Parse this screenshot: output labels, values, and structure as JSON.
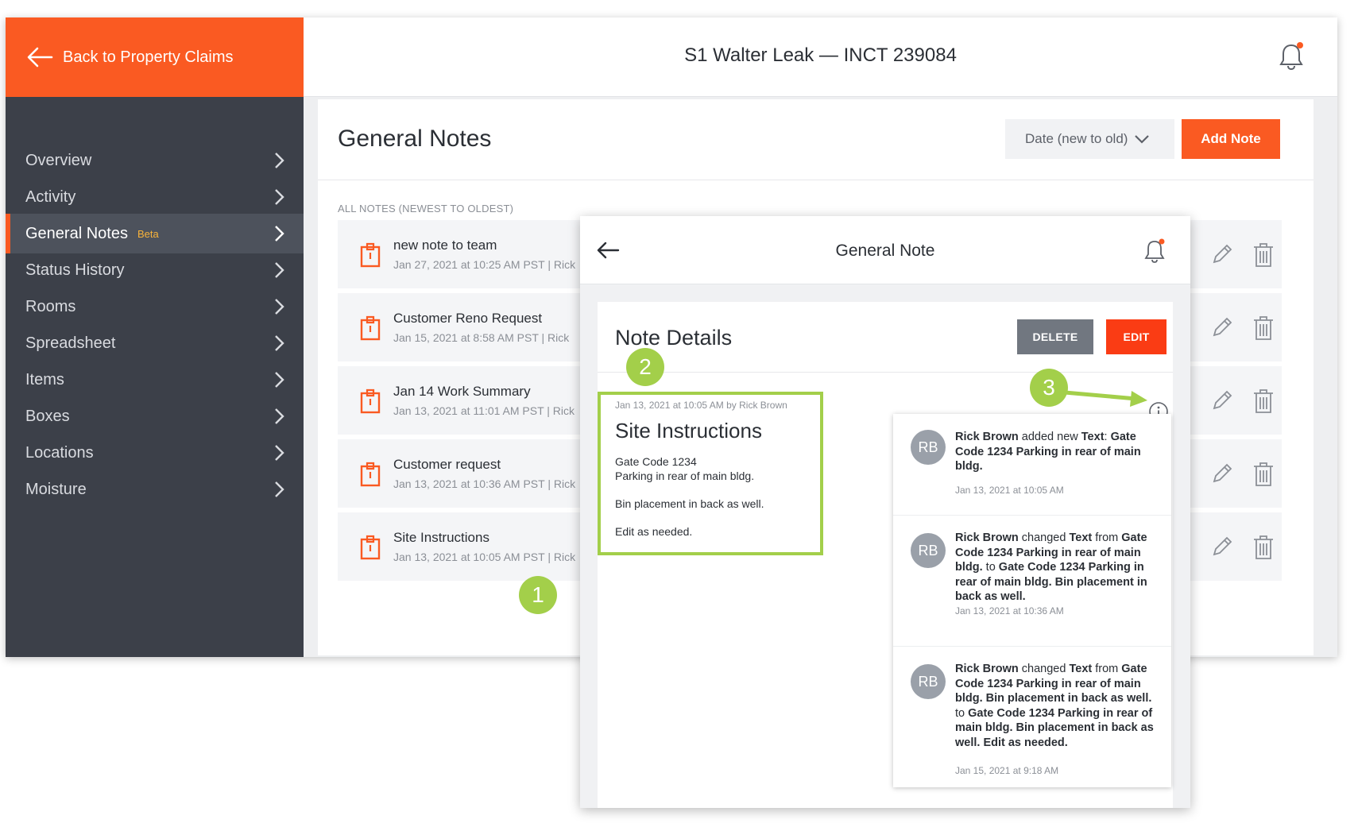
{
  "back_label": "Back to Property Claims",
  "header": {
    "title": "S1 Walter Leak — INCT 239084",
    "notification_dot_color": "#fa5a22"
  },
  "sidebar": {
    "items": [
      {
        "label": "Overview"
      },
      {
        "label": "Activity"
      },
      {
        "label": "General Notes",
        "badge": "Beta",
        "active": true
      },
      {
        "label": "Status History"
      },
      {
        "label": "Rooms"
      },
      {
        "label": "Spreadsheet"
      },
      {
        "label": "Items"
      },
      {
        "label": "Boxes"
      },
      {
        "label": "Locations"
      },
      {
        "label": "Moisture"
      }
    ]
  },
  "notes": {
    "title": "General Notes",
    "sort_label": "Date (new to old)",
    "add_label": "Add Note",
    "list_caption": "ALL NOTES (NEWEST TO OLDEST)",
    "items": [
      {
        "title": "new note to team",
        "meta": "Jan 27, 2021 at 10:25 AM PST | Rick"
      },
      {
        "title": "Customer Reno Request",
        "meta": "Jan 15, 2021 at 8:58 AM PST | Rick"
      },
      {
        "title": "Jan 14 Work Summary",
        "meta": "Jan 13, 2021 at 11:01 AM PST | Rick"
      },
      {
        "title": "Customer request",
        "meta": "Jan 13, 2021 at 10:36 AM PST | Rick"
      },
      {
        "title": "Site Instructions",
        "meta": "Jan 13, 2021 at 10:05 AM PST | Rick"
      }
    ]
  },
  "callouts": {
    "one": "1",
    "two": "2",
    "three": "3"
  },
  "modal": {
    "title": "General Note",
    "details_title": "Note Details",
    "delete_label": "DELETE",
    "edit_label": "EDIT",
    "note": {
      "meta": "Jan 13, 2021 at 10:05 AM by Rick Brown",
      "title": "Site Instructions",
      "line1": "Gate Code 1234",
      "line2": "Parking in rear of main bldg.",
      "line3": "Bin placement in back as well.",
      "line4": "Edit as needed."
    },
    "history": [
      {
        "avatar": "RB",
        "user": "Rick Brown",
        "action": "added new",
        "field": "Text",
        "colon": ":",
        "value": "Gate Code 1234 Parking in rear of main bldg.",
        "date": "Jan 13, 2021 at 10:05 AM"
      },
      {
        "avatar": "RB",
        "user": "Rick Brown",
        "action": "changed",
        "field": "Text",
        "from_word": "from",
        "old_value": "Gate Code 1234 Parking in rear of main bldg.",
        "to_word": "to",
        "new_value": "Gate Code 1234 Parking in rear of main bldg. Bin placement in back as well.",
        "date": "Jan 13, 2021 at 10:36 AM"
      },
      {
        "avatar": "RB",
        "user": "Rick Brown",
        "action": "changed",
        "field": "Text",
        "from_word": "from",
        "old_value": "Gate Code 1234 Parking in rear of main bldg. Bin placement in back as well.",
        "to_word": "to",
        "new_value": "Gate Code 1234 Parking in rear of main bldg. Bin placement in back as well. Edit as needed.",
        "date": "Jan 15, 2021 at 9:18 AM"
      }
    ]
  }
}
